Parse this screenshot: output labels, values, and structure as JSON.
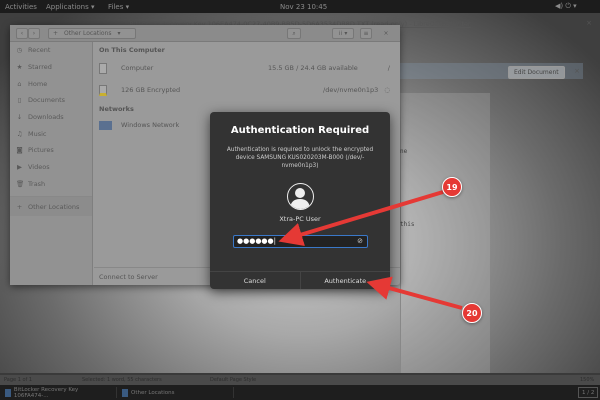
{
  "topbar": {
    "activities": "Activities",
    "applications": "Applications ▾",
    "files": "Files ▾",
    "clock": "Nov 23  10:45",
    "status_icons": "◀) ⏻ ▾"
  },
  "writer": {
    "title": "BitLocker Recovery Key 106EA474-0C27-40B9-BB5D-5D6A3534DB8D.TXT (read-only) - LibreOffice Writer",
    "edit_document": "Edit Document",
    "close": "×",
    "doc_lines": [
      "ne",
      "this"
    ]
  },
  "statusbar": {
    "page": "Page 1 of 1",
    "selected": "Selected: 1 word, 55 characters",
    "style": "Default Page Style",
    "zoom": "150%"
  },
  "taskbar": {
    "items": [
      "BitLocker Recovery Key 106FA474-...",
      "Other Locations"
    ],
    "workspace": "1 / 2"
  },
  "files": {
    "location": "Other Locations",
    "sidebar": [
      {
        "icon": "clock-icon",
        "glyph": "◷",
        "label": "Recent"
      },
      {
        "icon": "star-icon",
        "glyph": "★",
        "label": "Starred"
      },
      {
        "icon": "home-icon",
        "glyph": "⌂",
        "label": "Home"
      },
      {
        "icon": "document-icon",
        "glyph": "▯",
        "label": "Documents"
      },
      {
        "icon": "download-icon",
        "glyph": "↓",
        "label": "Downloads"
      },
      {
        "icon": "music-icon",
        "glyph": "♫",
        "label": "Music"
      },
      {
        "icon": "camera-icon",
        "glyph": "◙",
        "label": "Pictures"
      },
      {
        "icon": "video-icon",
        "glyph": "▶",
        "label": "Videos"
      },
      {
        "icon": "trash-icon",
        "glyph": "🗑",
        "label": "Trash"
      }
    ],
    "other_locations": "Other Locations",
    "section_computer": "On This Computer",
    "computer": {
      "name": "Computer",
      "usage": "15.5 GB / 24.4 GB available",
      "path": "/"
    },
    "encrypted": {
      "name": "126 GB Encrypted",
      "path": "/dev/nvme0n1p3"
    },
    "section_networks": "Networks",
    "network": {
      "name": "Windows Network"
    },
    "connect": "Connect to Server"
  },
  "dialog": {
    "title": "Authentication Required",
    "message": "Authentication is required to unlock the encrypted device SAMSUNG KUS020203M-B000 (/dev/-nvme0n1p3)",
    "user": "Xtra-PC User",
    "password": "●●●●●●|",
    "cancel": "Cancel",
    "authenticate": "Authenticate"
  },
  "annotations": {
    "step1": "19",
    "step2": "20",
    "color": "#e53935"
  }
}
